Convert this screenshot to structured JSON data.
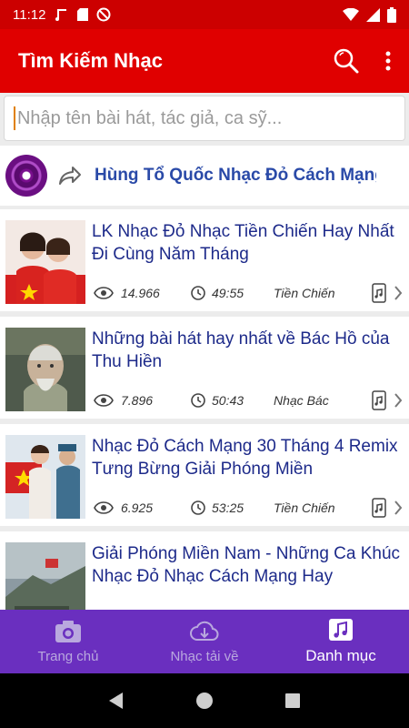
{
  "status": {
    "time": "11:12"
  },
  "appbar": {
    "title": "Tìm Kiếm Nhạc"
  },
  "search": {
    "placeholder": "Nhập tên bài hát, tác giả, ca sỹ..."
  },
  "now_playing": {
    "title": "Hùng Tổ Quốc Nhạc Đỏ Cách Mạng"
  },
  "list": [
    {
      "title": "LK Nhạc Đỏ Nhạc Tiền Chiến Hay Nhất Đi Cùng Năm Tháng",
      "views": "14.966",
      "duration": "49:55",
      "category": "Tiền Chiến"
    },
    {
      "title": "Những bài hát hay nhất về Bác Hồ của Thu Hiền",
      "views": "7.896",
      "duration": "50:43",
      "category": "Nhạc Bác"
    },
    {
      "title": "Nhạc Đỏ Cách Mạng 30 Tháng 4 Remix Tưng Bừng Giải Phóng Miền",
      "views": "6.925",
      "duration": "53:25",
      "category": "Tiền Chiến"
    },
    {
      "title": "Giải Phóng Miền Nam - Những Ca Khúc Nhạc Đỏ Nhạc Cách Mạng Hay",
      "views": "",
      "duration": "",
      "category": ""
    }
  ],
  "bottom_nav": [
    {
      "label": "Trang chủ",
      "active": false
    },
    {
      "label": "Nhạc tải về",
      "active": false
    },
    {
      "label": "Danh mục",
      "active": true
    }
  ],
  "colors": {
    "status_bar": "#cc0000",
    "app_bar": "#e00000",
    "bottom_nav": "#6a2fbf",
    "title_text": "#1d2a8a"
  }
}
